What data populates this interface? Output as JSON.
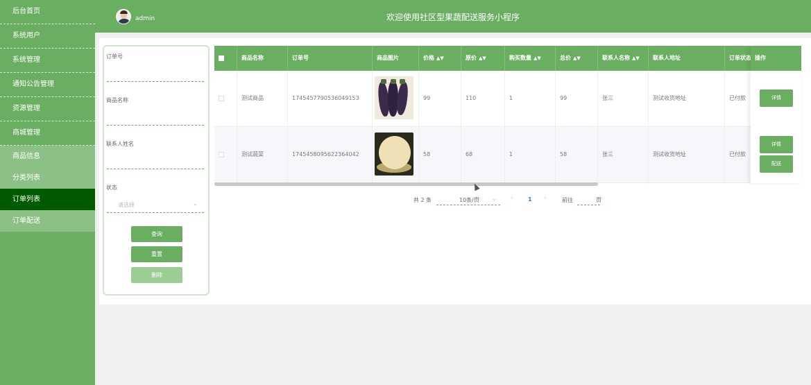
{
  "sidebar": {
    "items": [
      {
        "label": "后台首页"
      },
      {
        "label": "系统用户"
      },
      {
        "label": "系统管理"
      },
      {
        "label": "通知公告管理"
      },
      {
        "label": "资源管理"
      },
      {
        "label": "商城管理"
      }
    ],
    "sub_items": [
      {
        "label": "商品信息",
        "active": false
      },
      {
        "label": "分类列表",
        "active": false
      },
      {
        "label": "订单列表",
        "active": true
      },
      {
        "label": "订单配送",
        "active": false
      }
    ]
  },
  "header": {
    "username": "admin",
    "welcome": "欢迎使用社区型果蔬配送服务小程序"
  },
  "filter": {
    "order_no_label": "订单号",
    "product_name_label": "商品名称",
    "contact_name_label": "联系人姓名",
    "status_label": "状态",
    "status_placeholder": "请选择",
    "search_button": "查询",
    "reset_button": "重置",
    "delete_button": "删除"
  },
  "table": {
    "headers": {
      "product_name": "商品名称",
      "order_no": "订单号",
      "product_image": "商品图片",
      "price": "价格",
      "original_price": "原价",
      "quantity": "购买数量",
      "total": "总价",
      "contact_name": "联系人名称",
      "contact_address": "联系人地址",
      "order_status": "订单状态",
      "actions": "操作"
    },
    "rows": [
      {
        "product_name": "测试商品",
        "order_no": "1745457790536049153",
        "image": "eggplant",
        "price": "99",
        "original_price": "110",
        "quantity": "1",
        "total": "99",
        "contact_name": "张三",
        "contact_address": "测试收货地址",
        "order_status": "已付款",
        "actions": [
          "详情"
        ]
      },
      {
        "product_name": "测试蔬菜",
        "order_no": "1745458095622364042",
        "image": "cauliflower",
        "price": "58",
        "original_price": "68",
        "quantity": "1",
        "total": "58",
        "contact_name": "张三",
        "contact_address": "测试收货地址",
        "order_status": "已付款",
        "actions": [
          "详情",
          "配送"
        ]
      }
    ]
  },
  "pagination": {
    "total": "共 2 条",
    "page_size": "10条/页",
    "current_page": "1",
    "goto_label": "前往",
    "page_suffix": "页"
  },
  "colors": {
    "primary": "#6aae61",
    "active_nav": "#005a00",
    "sub_nav": "#8bc184"
  }
}
